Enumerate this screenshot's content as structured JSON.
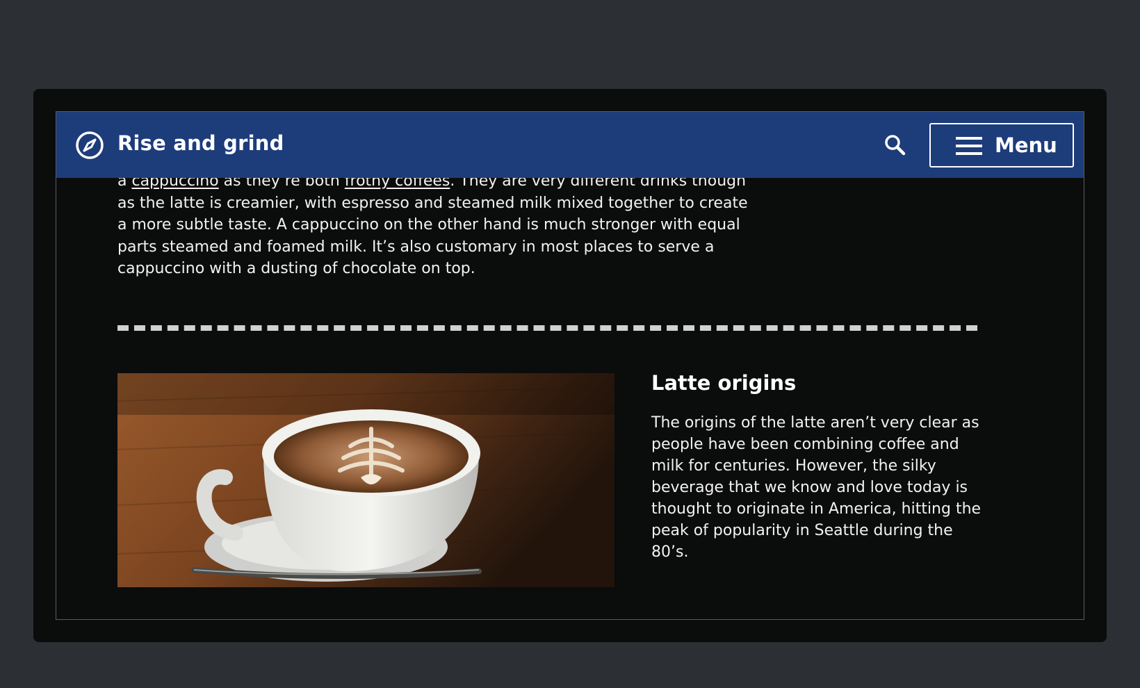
{
  "header": {
    "site_title": "Rise and grind",
    "logo_icon": "compass-icon",
    "search_icon": "search-icon",
    "menu_label": "Menu",
    "menu_icon": "hamburger-icon",
    "brand_color": "#1d3c7a"
  },
  "intro": {
    "prefix": "a ",
    "link_cappuccino": "cappuccino",
    "middle": " as they’re both ",
    "link_frothy": "frothy coffees",
    "rest": ". They are very different drinks though as the latte is creamier, with espresso and steamed milk mixed together to create a more subtle taste. A cappuccino on the other hand is much stronger with equal parts steamed and foamed milk. It’s also customary in most places to serve a cappuccino with a dusting of chocolate on top."
  },
  "origins": {
    "heading": "Latte origins",
    "body": "The origins of the latte aren’t very clear as people have been combining coffee and milk for centuries. However, the silky beverage that we know and love today is thought to originate in America, hitting the peak of popularity in Seattle during the 80’s."
  }
}
